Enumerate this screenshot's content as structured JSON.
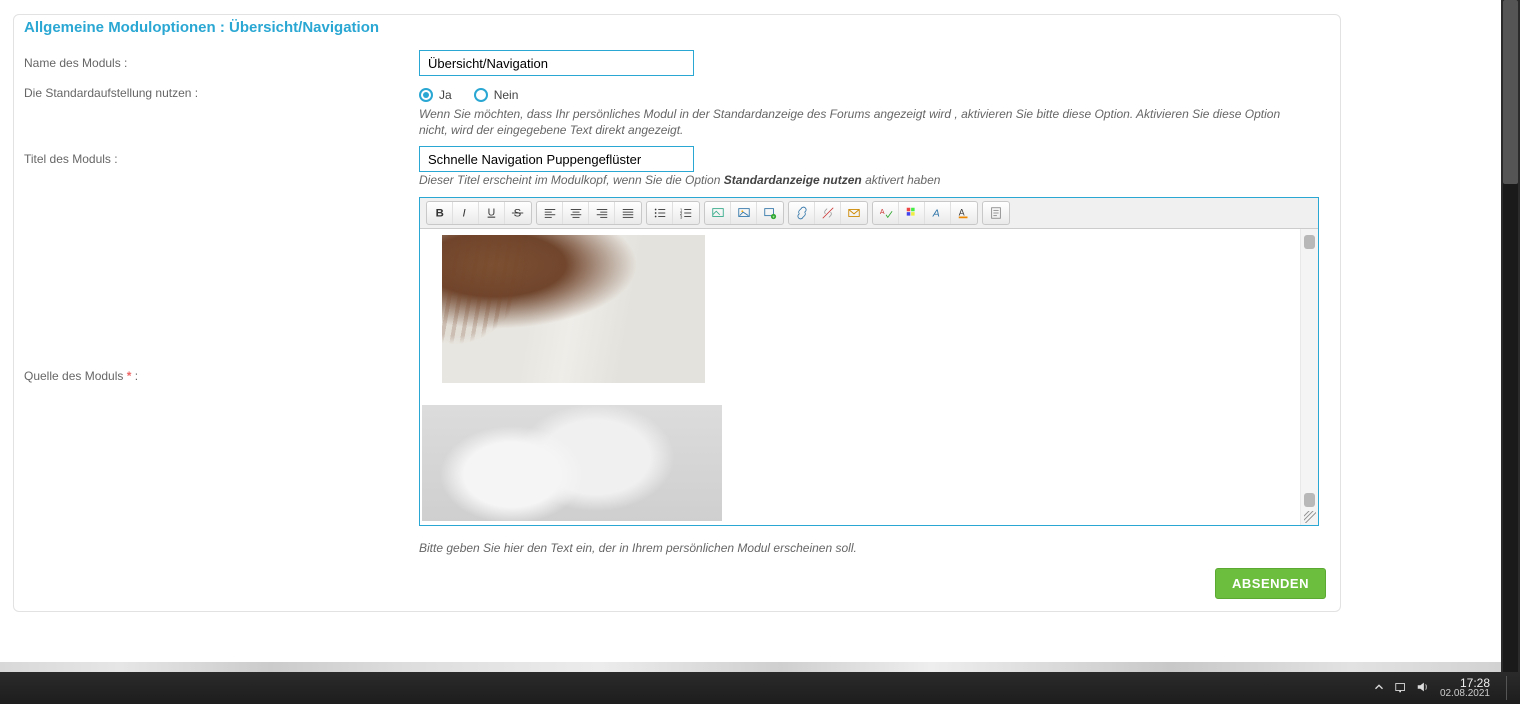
{
  "header": {
    "title": "Allgemeine Moduloptionen : Übersicht/Navigation"
  },
  "form": {
    "module_name_label": "Name des Moduls :",
    "module_name_value": "Übersicht/Navigation",
    "use_default_label": "Die Standardaufstellung nutzen :",
    "radio_yes": "Ja",
    "radio_no": "Nein",
    "use_default_hint": "Wenn Sie möchten, dass Ihr persönliches Modul in der Standardanzeige des Forums angezeigt wird , aktivieren Sie bitte diese Option. Aktivieren Sie diese Option nicht, wird der eingegebene Text direkt angezeigt.",
    "module_title_label": "Titel des Moduls :",
    "module_title_value": "Schnelle Navigation Puppengeflüster",
    "module_title_hint_pre": "Dieser Titel erscheint im Modulkopf, wenn Sie die Option ",
    "module_title_hint_strong": "Standardanzeige nutzen",
    "module_title_hint_post": " aktivert haben",
    "module_source_label": "Quelle des Moduls ",
    "module_source_suffix": " :",
    "editor_hint": "Bitte geben Sie hier den Text ein, der in Ihrem persönlichen Modul erscheinen soll.",
    "submit": "ABSENDEN"
  },
  "taskbar": {
    "time": "17:28",
    "date": "02.08.2021"
  },
  "icons": {
    "bold": "bold-icon",
    "italic": "italic-icon",
    "underline": "underline-icon",
    "strike": "strike-icon",
    "align_left": "align-left-icon",
    "align_center": "align-center-icon",
    "align_right": "align-right-icon",
    "align_justify": "align-justify-icon",
    "list_ul": "list-ul-icon",
    "list_ol": "list-ol-icon",
    "img_host": "image-host-icon",
    "img_insert": "image-icon",
    "img_plus": "image-add-icon",
    "link": "link-icon",
    "unlink": "unlink-icon",
    "mail": "mail-icon",
    "spellcheck": "spellcheck-icon",
    "color": "color-grid-icon",
    "font": "font-icon",
    "font_plus_a": "font-color-icon",
    "source": "source-icon"
  }
}
